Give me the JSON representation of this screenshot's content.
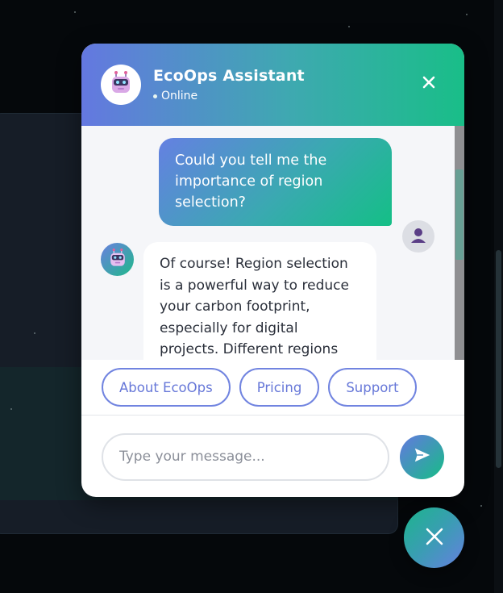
{
  "header": {
    "title": "EcoOps Assistant",
    "status": "Online"
  },
  "messages": [
    {
      "sender": "user",
      "text": "Could you tell me the importance of region selection?"
    },
    {
      "sender": "bot",
      "text": "Of course! Region selection is a powerful way to reduce your carbon footprint, especially for digital projects. Different regions"
    }
  ],
  "quick_replies": [
    "About EcoOps",
    "Pricing",
    "Support"
  ],
  "input": {
    "placeholder": "Type your message..."
  },
  "colors": {
    "brand_gradient_start": "#6478e0",
    "brand_gradient_end": "#16bd86",
    "chip_border": "#7184e0"
  },
  "icons": {
    "header_avatar": "robot-icon",
    "header_close": "close-icon",
    "user_avatar": "user-silhouette-icon",
    "bot_avatar": "robot-icon",
    "send": "paper-plane-icon",
    "fab": "close-icon"
  }
}
